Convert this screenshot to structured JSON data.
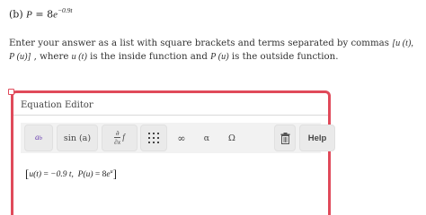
{
  "question": {
    "part": "(b)",
    "lhs": "P",
    "eq": "=",
    "coef": "8",
    "base": "e",
    "exponent": "−0.9t"
  },
  "instructions": {
    "text_1": "Enter your answer as a list with square brackets and terms separated by commas ",
    "math_1": "[u (t),  P (u)]",
    "text_2": " , where ",
    "math_2": "u (t)",
    "text_3": " is the inside function and ",
    "math_3": "P (u)",
    "text_4": " is the outside function."
  },
  "editor": {
    "title": "Equation Editor",
    "toolbar": {
      "superscript": {
        "base": "a",
        "exp": "b"
      },
      "function": "sin (a)",
      "partial": {
        "num": "∂",
        "den": "∂x",
        "f": "f"
      },
      "infinity": "∞",
      "alpha": "α",
      "omega": "Ω",
      "help": "Help"
    },
    "answer": {
      "open": "[",
      "u_lhs": "u(t)",
      "eq1": " = ",
      "u_rhs": "−0.9 t,",
      "p_lhs": "P(u)",
      "eq2": " = ",
      "p_coef": "8",
      "p_base": "e",
      "p_exp": "u",
      "close": "]"
    }
  },
  "colors": {
    "editor_border": "#e04a5a",
    "template_accent": "#6a3fb0"
  },
  "icons": [
    "grid-icon",
    "trash-icon"
  ]
}
